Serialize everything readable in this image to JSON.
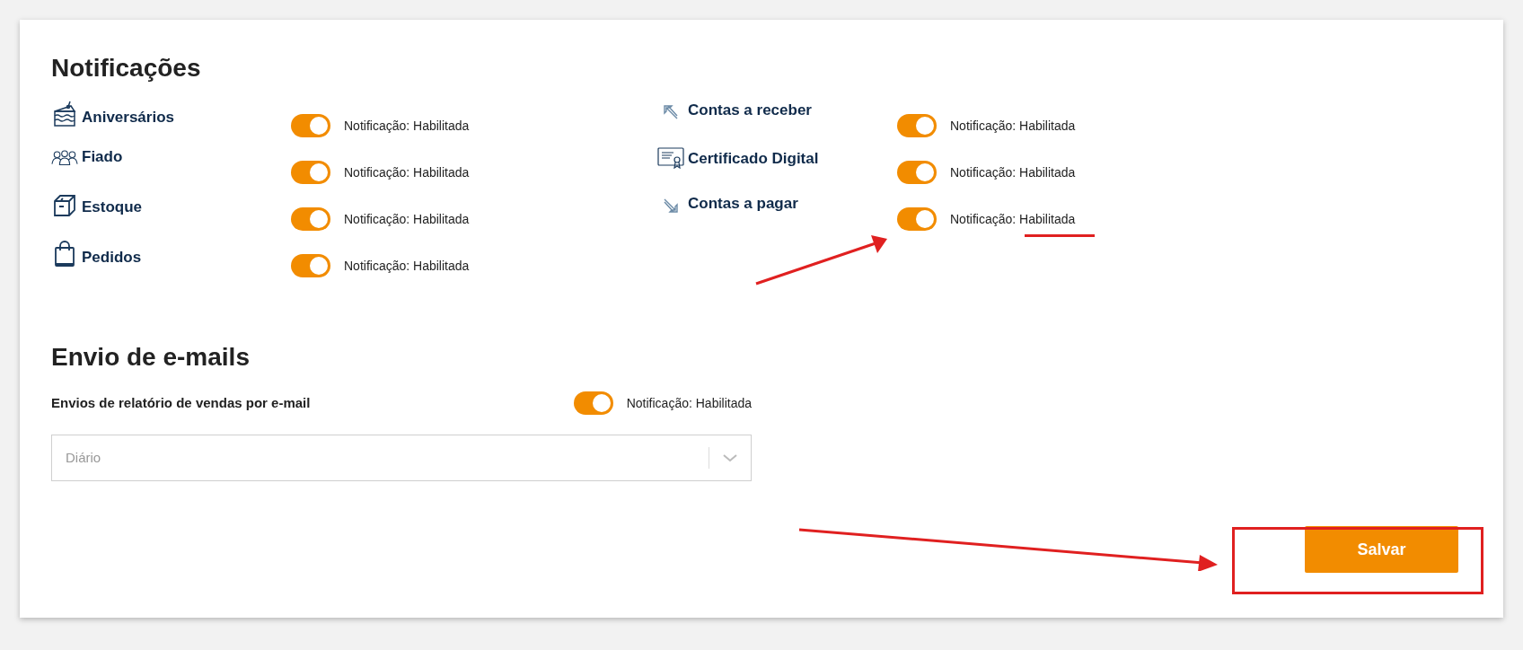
{
  "notifications": {
    "title": "Notificações",
    "columns": [
      [
        {
          "label": "Aniversários",
          "on": true,
          "status": "Notificação: Habilitada"
        },
        {
          "label": "Fiado",
          "on": true,
          "status": "Notificação: Habilitada"
        },
        {
          "label": "Estoque",
          "on": true,
          "status": "Notificação: Habilitada"
        },
        {
          "label": "Pedidos",
          "on": true,
          "status": "Notificação: Habilitada"
        }
      ],
      [
        {
          "label": "Contas a receber",
          "on": true,
          "status": "Notificação: Habilitada"
        },
        {
          "label": "Certificado Digital",
          "on": true,
          "status": "Notificação: Habilitada"
        },
        {
          "label": "Contas a pagar",
          "on": true,
          "status": "Notificação: Habilitada"
        }
      ]
    ]
  },
  "emails": {
    "title": "Envio de e-mails",
    "report": {
      "label": "Envios de relatório de vendas por e-mail",
      "on": true,
      "status": "Notificação: Habilitada"
    },
    "frequency": {
      "placeholder": "Diário"
    }
  },
  "save_button": "Salvar"
}
